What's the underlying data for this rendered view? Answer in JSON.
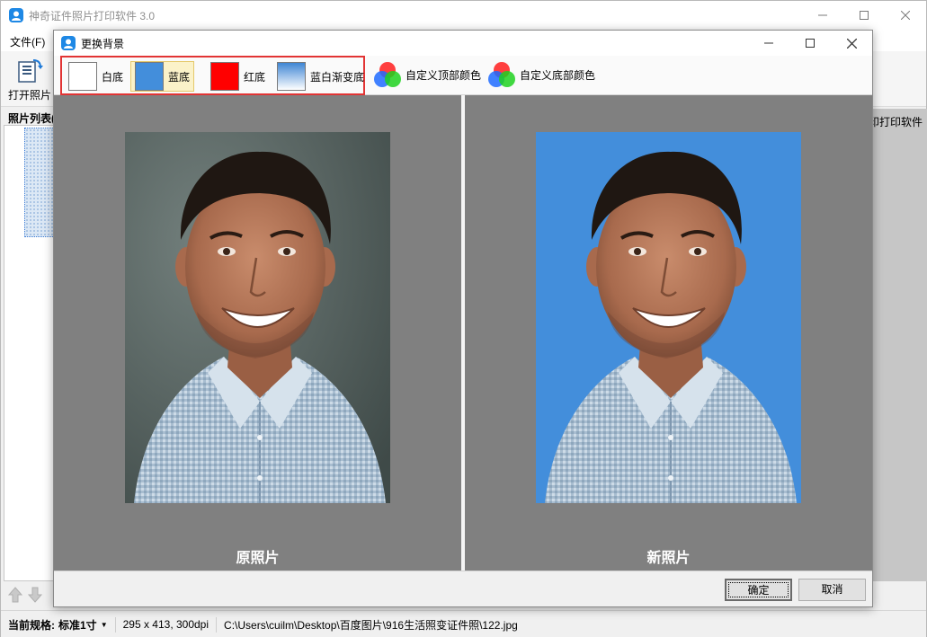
{
  "app": {
    "title": "神奇证件照片打印软件 3.0",
    "menu_file": "文件(F)",
    "toolbar_open_label": "打开照片",
    "photo_list_header": "照片列表(",
    "right_panel_text": "印打印软件"
  },
  "status": {
    "spec_label": "当前规格:",
    "spec_value": "标准1寸",
    "size_info": "295 x 413, 300dpi",
    "file_path": "C:\\Users\\cuilm\\Desktop\\百度图片\\916生活照变证件照\\122.jpg"
  },
  "dialog": {
    "title": "更换背景",
    "options": [
      {
        "label": "白底",
        "color": "#ffffff"
      },
      {
        "label": "蓝底",
        "color": "#438edb",
        "selected": true
      },
      {
        "label": "红底",
        "color": "#ff0000"
      },
      {
        "label": "蓝白渐变底",
        "color": "#4a90d9"
      }
    ],
    "custom_top_label": "自定义顶部颜色",
    "custom_bottom_label": "自定义底部颜色",
    "original_caption": "原照片",
    "new_caption": "新照片",
    "new_background_color": "#438edb",
    "original_background_color": "#5b6865",
    "ok_label": "确定",
    "cancel_label": "取消"
  },
  "colors": {
    "highlight_border": "#e23434",
    "selected_fill": "#fbf2c9",
    "preview_gray": "#808080"
  }
}
